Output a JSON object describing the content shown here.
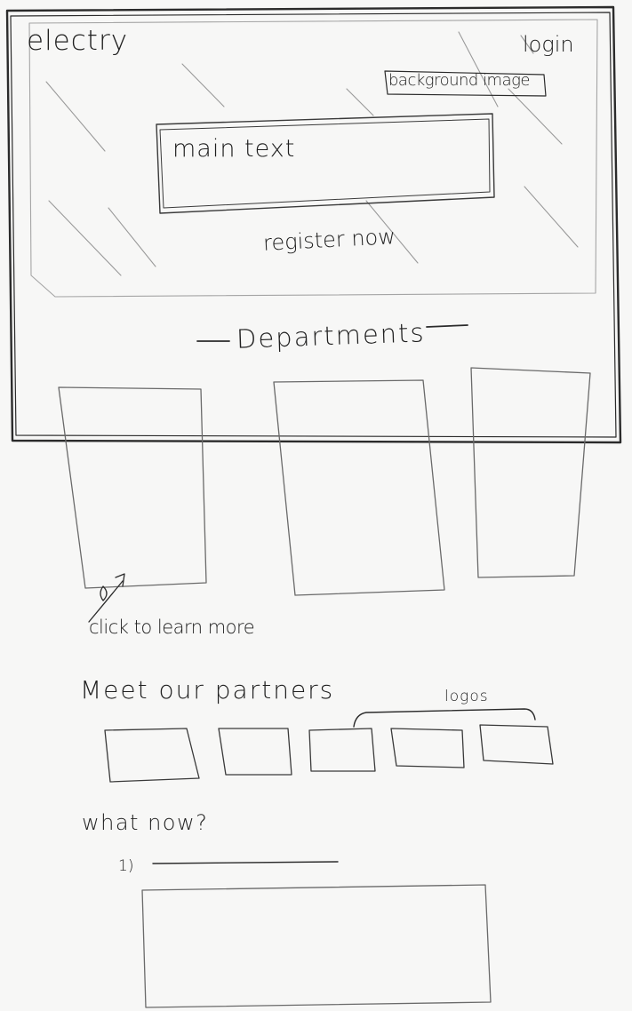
{
  "header": {
    "brand": "electry",
    "login_label": "login"
  },
  "hero": {
    "background_note": "background image",
    "main_text": "main text",
    "cta_label": "register now"
  },
  "departments": {
    "heading": "Departments",
    "card_count": 3,
    "annotation": "click to learn more"
  },
  "partners": {
    "heading": "Meet our partners",
    "logos_note": "logos",
    "logo_count": 5
  },
  "next_steps": {
    "heading": "what now?",
    "step_number": "1)"
  }
}
